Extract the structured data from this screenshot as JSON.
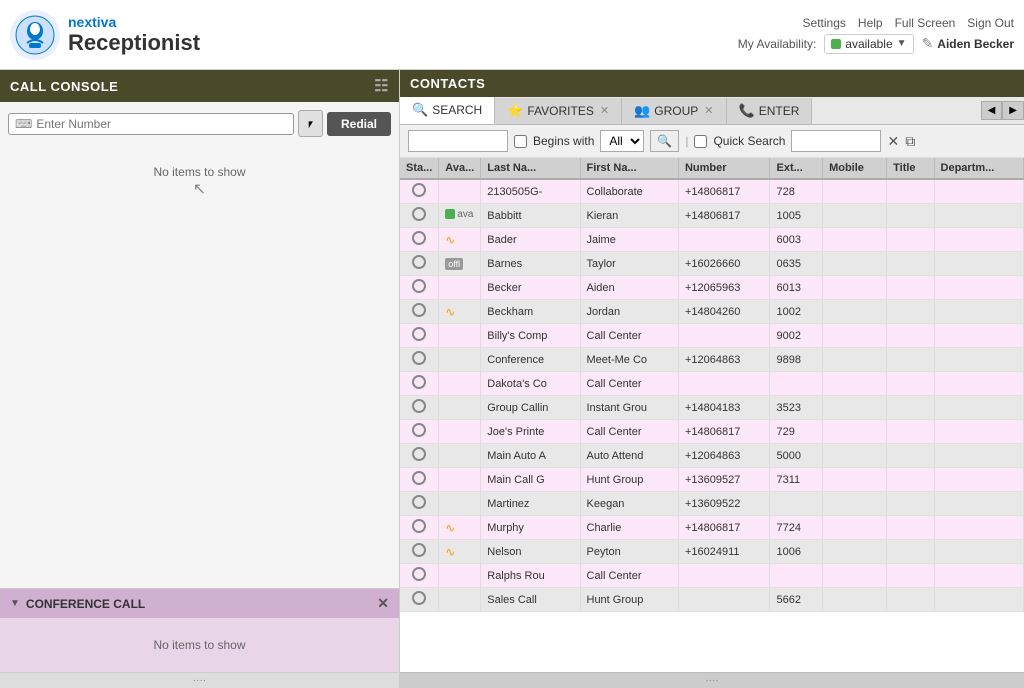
{
  "topbar": {
    "brand": "nextiva",
    "title": "Receptionist",
    "nav": [
      "Settings",
      "Help",
      "Full Screen",
      "Sign Out"
    ],
    "avail_label": "My Availability:",
    "avail_status": "available",
    "pencil": "✎",
    "username": "Aiden Becker"
  },
  "call_console": {
    "header": "CALL CONSOLE",
    "enter_number_placeholder": "Enter Number",
    "redial_label": "Redial",
    "no_items": "No items to show",
    "conference": {
      "header": "CONFERENCE CALL",
      "no_items": "No items to show"
    }
  },
  "contacts": {
    "header": "CONTACTS",
    "tabs": [
      {
        "id": "search",
        "label": "SEARCH",
        "icon": "🔍",
        "closeable": false,
        "active": true
      },
      {
        "id": "favorites",
        "label": "FAVORITES",
        "icon": "⭐",
        "closeable": true,
        "active": false
      },
      {
        "id": "group",
        "label": "GROUP",
        "icon": "👥",
        "closeable": true,
        "active": false
      },
      {
        "id": "enter",
        "label": "ENTER",
        "icon": "📞",
        "closeable": false,
        "active": false
      }
    ],
    "filter": {
      "begins_with_label": "Begins with",
      "all_option": "All",
      "quick_search_label": "Quick Search",
      "search_placeholder": ""
    },
    "columns": [
      "Sta...",
      "Ava...",
      "Last Na...",
      "First Na...",
      "Number",
      "Ext...",
      "Mobile",
      "Title",
      "Departm..."
    ],
    "rows": [
      {
        "status": "",
        "avail": "",
        "last": "2130505G-",
        "first": "Collaborate",
        "number": "+14806817",
        "ext": "728",
        "mobile": "",
        "title": "",
        "dept": ""
      },
      {
        "status": "",
        "avail": "green",
        "last": "Babbitt",
        "first": "Kieran",
        "number": "+14806817",
        "ext": "1005",
        "mobile": "",
        "title": "",
        "dept": ""
      },
      {
        "status": "",
        "avail": "rss",
        "last": "Bader",
        "first": "Jaime",
        "number": "",
        "ext": "6003",
        "mobile": "",
        "title": "",
        "dept": ""
      },
      {
        "status": "",
        "avail": "offline",
        "last": "Barnes",
        "first": "Taylor",
        "number": "+16026660",
        "ext": "0635",
        "mobile": "",
        "title": "",
        "dept": ""
      },
      {
        "status": "",
        "avail": "",
        "last": "Becker",
        "first": "Aiden",
        "number": "+12065963",
        "ext": "6013",
        "mobile": "",
        "title": "",
        "dept": ""
      },
      {
        "status": "",
        "avail": "rss",
        "last": "Beckham",
        "first": "Jordan",
        "number": "+14804260",
        "ext": "1002",
        "mobile": "",
        "title": "",
        "dept": ""
      },
      {
        "status": "",
        "avail": "",
        "last": "Billy's Comp",
        "first": "Call Center",
        "number": "",
        "ext": "9002",
        "mobile": "",
        "title": "",
        "dept": ""
      },
      {
        "status": "",
        "avail": "",
        "last": "Conference",
        "first": "Meet-Me Co",
        "number": "+12064863",
        "ext": "9898",
        "mobile": "",
        "title": "",
        "dept": ""
      },
      {
        "status": "",
        "avail": "",
        "last": "Dakota's Co",
        "first": "Call Center",
        "number": "",
        "ext": "",
        "mobile": "",
        "title": "",
        "dept": ""
      },
      {
        "status": "",
        "avail": "",
        "last": "Group Callin",
        "first": "Instant Grou",
        "number": "+14804183",
        "ext": "3523",
        "mobile": "",
        "title": "",
        "dept": ""
      },
      {
        "status": "",
        "avail": "",
        "last": "Joe's Printe",
        "first": "Call Center",
        "number": "+14806817",
        "ext": "729",
        "mobile": "",
        "title": "",
        "dept": ""
      },
      {
        "status": "",
        "avail": "",
        "last": "Main Auto A",
        "first": "Auto Attend",
        "number": "+12064863",
        "ext": "5000",
        "mobile": "",
        "title": "",
        "dept": ""
      },
      {
        "status": "",
        "avail": "",
        "last": "Main Call G",
        "first": "Hunt Group",
        "number": "+13609527",
        "ext": "7311",
        "mobile": "",
        "title": "",
        "dept": ""
      },
      {
        "status": "",
        "avail": "",
        "last": "Martinez",
        "first": "Keegan",
        "number": "+13609522",
        "ext": "",
        "mobile": "",
        "title": "",
        "dept": ""
      },
      {
        "status": "",
        "avail": "rss",
        "last": "Murphy",
        "first": "Charlie",
        "number": "+14806817",
        "ext": "7724",
        "mobile": "",
        "title": "",
        "dept": ""
      },
      {
        "status": "",
        "avail": "rss",
        "last": "Nelson",
        "first": "Peyton",
        "number": "+16024911",
        "ext": "1006",
        "mobile": "",
        "title": "",
        "dept": ""
      },
      {
        "status": "",
        "avail": "",
        "last": "Ralphs Rou",
        "first": "Call Center",
        "number": "",
        "ext": "",
        "mobile": "",
        "title": "",
        "dept": ""
      },
      {
        "status": "",
        "avail": "",
        "last": "Sales Call",
        "first": "Hunt Group",
        "number": "",
        "ext": "5662",
        "mobile": "",
        "title": "",
        "dept": ""
      }
    ]
  }
}
